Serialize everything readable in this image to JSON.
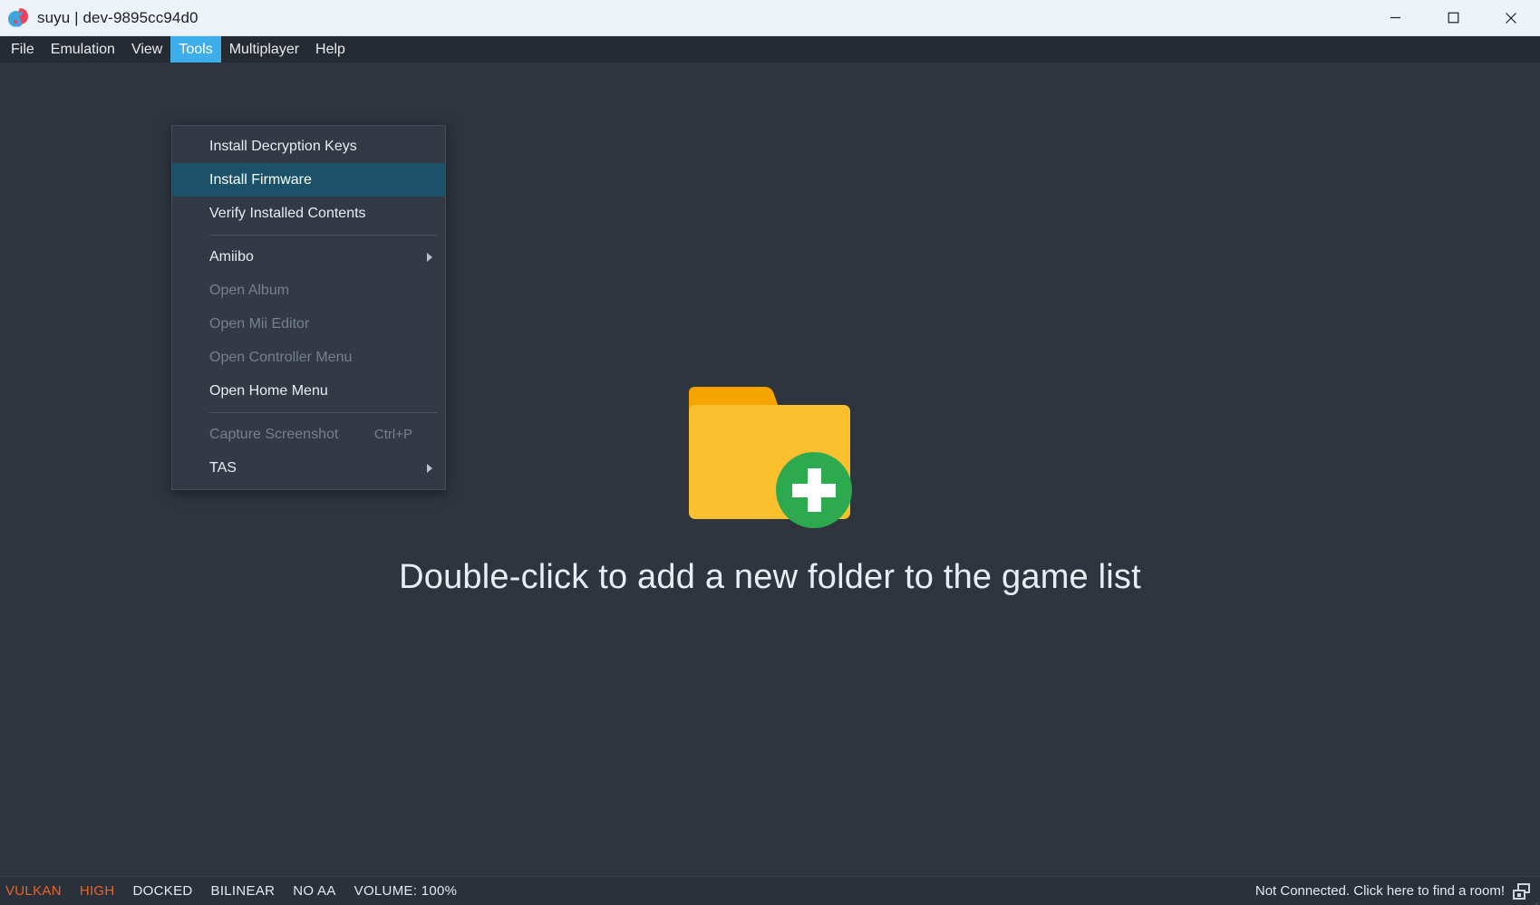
{
  "window": {
    "title": "suyu | dev-9895cc94d0",
    "logo_icon": "suyu-yin-yang-logo",
    "controls": {
      "minimize_label": "Minimize",
      "maximize_label": "Maximize",
      "close_label": "Close"
    }
  },
  "menubar": {
    "items": [
      {
        "label": "File",
        "active": false
      },
      {
        "label": "Emulation",
        "active": false
      },
      {
        "label": "View",
        "active": false
      },
      {
        "label": "Tools",
        "active": true
      },
      {
        "label": "Multiplayer",
        "active": false
      },
      {
        "label": "Help",
        "active": false
      }
    ]
  },
  "tools_menu": {
    "open": true,
    "items": [
      {
        "type": "item",
        "label": "Install Decryption Keys",
        "shortcut": "",
        "disabled": false,
        "highlighted": false,
        "submenu": false
      },
      {
        "type": "item",
        "label": "Install Firmware",
        "shortcut": "",
        "disabled": false,
        "highlighted": true,
        "submenu": false
      },
      {
        "type": "item",
        "label": "Verify Installed Contents",
        "shortcut": "",
        "disabled": false,
        "highlighted": false,
        "submenu": false
      },
      {
        "type": "separator"
      },
      {
        "type": "item",
        "label": "Amiibo",
        "shortcut": "",
        "disabled": false,
        "highlighted": false,
        "submenu": true
      },
      {
        "type": "item",
        "label": "Open Album",
        "shortcut": "",
        "disabled": true,
        "highlighted": false,
        "submenu": false
      },
      {
        "type": "item",
        "label": "Open Mii Editor",
        "shortcut": "",
        "disabled": true,
        "highlighted": false,
        "submenu": false
      },
      {
        "type": "item",
        "label": "Open Controller Menu",
        "shortcut": "",
        "disabled": true,
        "highlighted": false,
        "submenu": false
      },
      {
        "type": "item",
        "label": "Open Home Menu",
        "shortcut": "",
        "disabled": false,
        "highlighted": false,
        "submenu": false
      },
      {
        "type": "separator"
      },
      {
        "type": "item",
        "label": "Capture Screenshot",
        "shortcut": "Ctrl+P",
        "disabled": true,
        "highlighted": false,
        "submenu": false
      },
      {
        "type": "item",
        "label": "TAS",
        "shortcut": "",
        "disabled": false,
        "highlighted": false,
        "submenu": true
      }
    ]
  },
  "main": {
    "folder_icon": "add-folder-icon",
    "empty_message": "Double-click to add a new folder to the game list"
  },
  "statusbar": {
    "chips": [
      {
        "label": "VULKAN",
        "accent": true
      },
      {
        "label": "HIGH",
        "accent": true
      },
      {
        "label": "DOCKED",
        "accent": false
      },
      {
        "label": "BILINEAR",
        "accent": false
      },
      {
        "label": "NO AA",
        "accent": false
      },
      {
        "label": "VOLUME: 100%",
        "accent": false
      }
    ],
    "network_text": "Not Connected. Click here to find a room!",
    "network_icon": "multiplayer-room-icon"
  },
  "colors": {
    "menubar_highlight": "#3daee9",
    "menu_item_highlight": "#1b5269",
    "status_accent": "#e8642a",
    "window_background": "#2f353f",
    "titlebar_background": "#eef3f8",
    "folder_yellow": "#fbc02d",
    "folder_tab_orange": "#f7a400",
    "plus_green": "#2eaa4e"
  }
}
